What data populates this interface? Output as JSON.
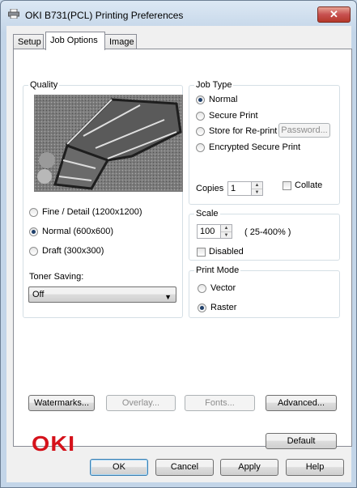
{
  "window": {
    "title": "OKI B731(PCL) Printing Preferences",
    "close_glyph": "✕"
  },
  "tabs": [
    {
      "label": "Setup"
    },
    {
      "label": "Job Options"
    },
    {
      "label": "Image"
    }
  ],
  "active_tab": "Job Options",
  "quality": {
    "label": "Quality",
    "options": [
      {
        "label": "Fine / Detail (1200x1200)",
        "selected": false
      },
      {
        "label": "Normal (600x600)",
        "selected": true
      },
      {
        "label": "Draft (300x300)",
        "selected": false
      }
    ]
  },
  "toner": {
    "label": "Toner Saving:",
    "value": "Off"
  },
  "job_type": {
    "label": "Job Type",
    "options": [
      {
        "label": "Normal",
        "selected": true
      },
      {
        "label": "Secure Print",
        "selected": false
      },
      {
        "label": "Store for Re-print",
        "selected": false
      },
      {
        "label": "Encrypted Secure Print",
        "selected": false
      }
    ],
    "password_button": "Password...",
    "copies_label": "Copies",
    "copies_value": "1",
    "collate_label": "Collate",
    "collate_checked": false
  },
  "scale": {
    "label": "Scale",
    "value": "100",
    "range": "( 25-400% )",
    "disabled_label": "Disabled",
    "disabled_checked": false
  },
  "print_mode": {
    "label": "Print Mode",
    "options": [
      {
        "label": "Vector",
        "selected": false
      },
      {
        "label": "Raster",
        "selected": true
      }
    ]
  },
  "buttons": {
    "watermarks": "Watermarks...",
    "overlay": "Overlay...",
    "fonts": "Fonts...",
    "advanced": "Advanced...",
    "default": "Default",
    "ok": "OK",
    "cancel": "Cancel",
    "apply": "Apply",
    "help": "Help"
  },
  "brand": {
    "logo_text": "OKI",
    "color": "#d5121b"
  },
  "icons": {
    "app": "printer-icon",
    "spin_up": "▲",
    "spin_down": "▼",
    "dropdown": "▼"
  }
}
